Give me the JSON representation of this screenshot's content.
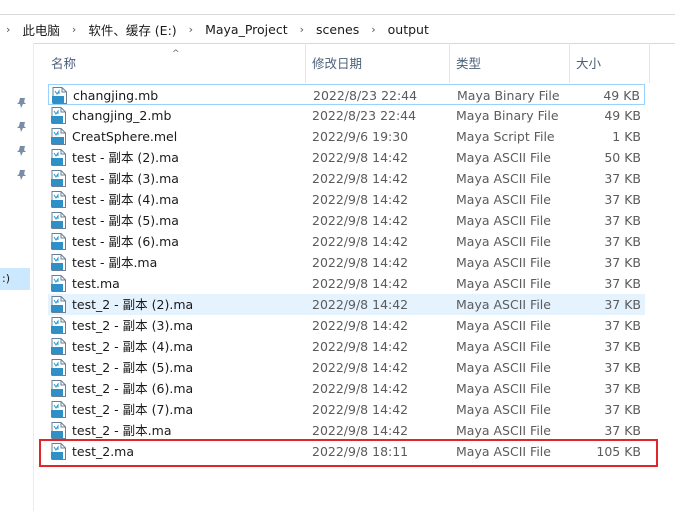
{
  "breadcrumb": [
    "此电脑",
    "软件、缓存 (E:)",
    "Maya_Project",
    "scenes",
    "output"
  ],
  "nav_fragment": ":)",
  "columns": {
    "name": "名称",
    "date": "修改日期",
    "type": "类型",
    "size": "大小"
  },
  "files": [
    {
      "name": "changjing.mb",
      "date": "2022/8/23 22:44",
      "type": "Maya Binary File",
      "size": "49 KB",
      "icon": "MB"
    },
    {
      "name": "changjing_2.mb",
      "date": "2022/8/23 22:44",
      "type": "Maya Binary File",
      "size": "49 KB",
      "icon": "MB"
    },
    {
      "name": "CreatSphere.mel",
      "date": "2022/9/6 19:30",
      "type": "Maya Script File",
      "size": "1 KB",
      "icon": "MEL"
    },
    {
      "name": "test - 副本 (2).ma",
      "date": "2022/9/8 14:42",
      "type": "Maya ASCII File",
      "size": "50 KB",
      "icon": "MA"
    },
    {
      "name": "test - 副本 (3).ma",
      "date": "2022/9/8 14:42",
      "type": "Maya ASCII File",
      "size": "37 KB",
      "icon": "MA"
    },
    {
      "name": "test - 副本 (4).ma",
      "date": "2022/9/8 14:42",
      "type": "Maya ASCII File",
      "size": "37 KB",
      "icon": "MA"
    },
    {
      "name": "test - 副本 (5).ma",
      "date": "2022/9/8 14:42",
      "type": "Maya ASCII File",
      "size": "37 KB",
      "icon": "MA"
    },
    {
      "name": "test - 副本 (6).ma",
      "date": "2022/9/8 14:42",
      "type": "Maya ASCII File",
      "size": "37 KB",
      "icon": "MA"
    },
    {
      "name": "test - 副本.ma",
      "date": "2022/9/8 14:42",
      "type": "Maya ASCII File",
      "size": "37 KB",
      "icon": "MA"
    },
    {
      "name": "test.ma",
      "date": "2022/9/8 14:42",
      "type": "Maya ASCII File",
      "size": "37 KB",
      "icon": "MA"
    },
    {
      "name": "test_2 - 副本 (2).ma",
      "date": "2022/9/8 14:42",
      "type": "Maya ASCII File",
      "size": "37 KB",
      "icon": "MA"
    },
    {
      "name": "test_2 - 副本 (3).ma",
      "date": "2022/9/8 14:42",
      "type": "Maya ASCII File",
      "size": "37 KB",
      "icon": "MA"
    },
    {
      "name": "test_2 - 副本 (4).ma",
      "date": "2022/9/8 14:42",
      "type": "Maya ASCII File",
      "size": "37 KB",
      "icon": "MA"
    },
    {
      "name": "test_2 - 副本 (5).ma",
      "date": "2022/9/8 14:42",
      "type": "Maya ASCII File",
      "size": "37 KB",
      "icon": "MA"
    },
    {
      "name": "test_2 - 副本 (6).ma",
      "date": "2022/9/8 14:42",
      "type": "Maya ASCII File",
      "size": "37 KB",
      "icon": "MA"
    },
    {
      "name": "test_2 - 副本 (7).ma",
      "date": "2022/9/8 14:42",
      "type": "Maya ASCII File",
      "size": "37 KB",
      "icon": "MA"
    },
    {
      "name": "test_2 - 副本.ma",
      "date": "2022/9/8 14:42",
      "type": "Maya ASCII File",
      "size": "37 KB",
      "icon": "MA"
    },
    {
      "name": "test_2.ma",
      "date": "2022/9/8 18:11",
      "type": "Maya ASCII File",
      "size": "105 KB",
      "icon": "MA"
    }
  ],
  "colors": {
    "highlight_box": "#e0262b",
    "hover_row": "#e5f3ff",
    "focus_border": "#99d1ff",
    "header_text": "#4c607a"
  }
}
